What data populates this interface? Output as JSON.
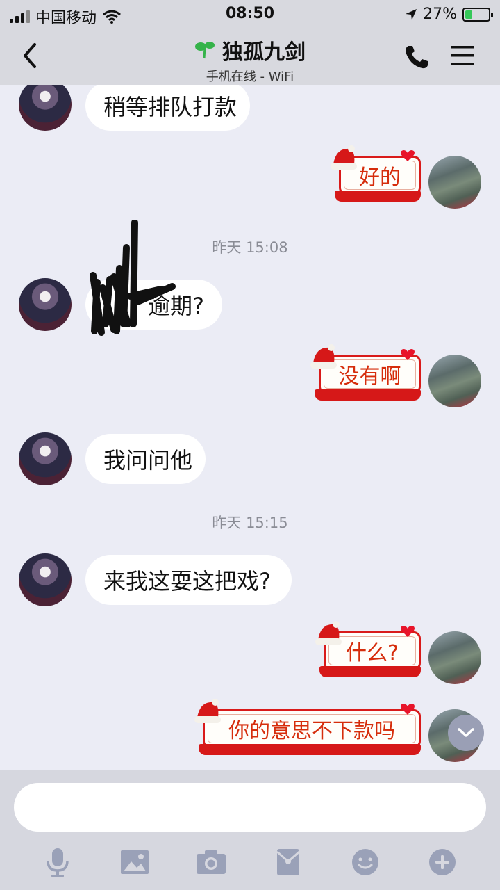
{
  "status": {
    "carrier": "中国移动",
    "time": "08:50",
    "battery": "27%"
  },
  "header": {
    "title": "独孤九剑",
    "subtitle": "手机在线 - WiFi"
  },
  "messages": {
    "m1": "稍等排队打款",
    "m2": "好的",
    "t1": "昨天 15:08",
    "m3": "逾期?",
    "m4": "没有啊",
    "m5": "我问问他",
    "t2": "昨天 15:15",
    "m6": "来我这耍这把戏?",
    "m7": "什么?",
    "m8": "你的意思不下款吗"
  },
  "composer": {
    "placeholder": ""
  },
  "icons": [
    "back-icon",
    "sprout-icon",
    "phone-icon",
    "menu-icon",
    "mic-icon",
    "image-icon",
    "camera-icon",
    "red-packet-icon",
    "emoji-icon",
    "plus-icon",
    "chevron-down-icon"
  ],
  "colors": {
    "header_bg": "#d8d9df",
    "chat_bg": "#ebecf5",
    "sticker_red": "#d61818",
    "sticker_text": "#d62d0c"
  }
}
